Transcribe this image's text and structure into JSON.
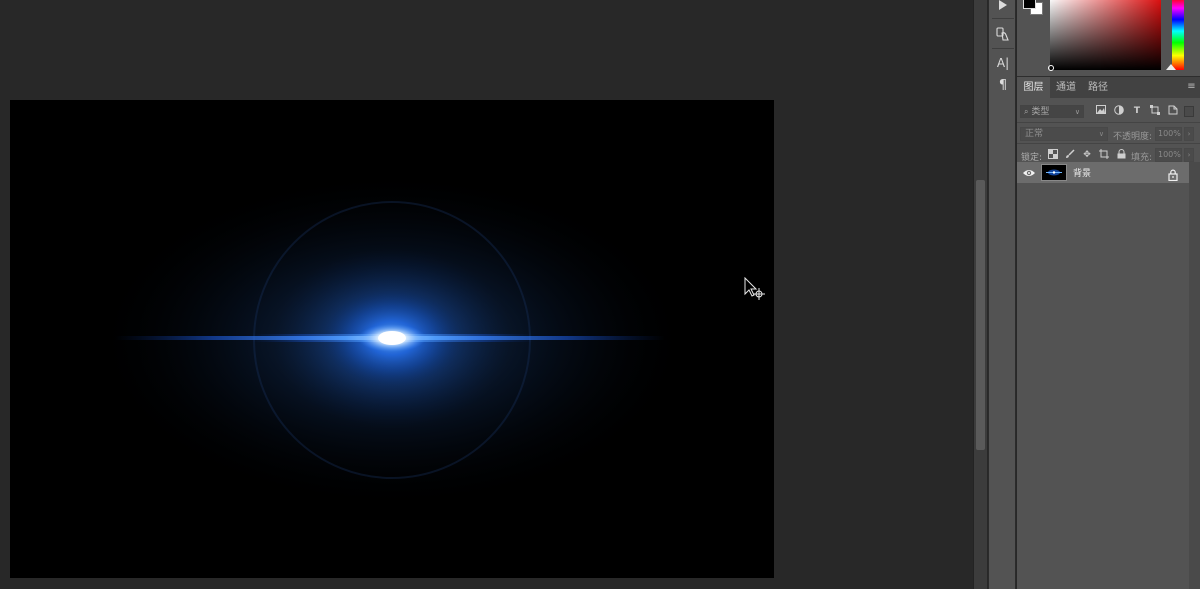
{
  "panel_tabs": [
    {
      "label": "图层",
      "active": true
    },
    {
      "label": "通道",
      "active": false
    },
    {
      "label": "路径",
      "active": false
    }
  ],
  "panel_menu_icon": "hamburger-menu-icon",
  "layers": {
    "filter": {
      "placeholder": "类型",
      "icons": [
        "image-filter-icon",
        "adjustment-filter-icon",
        "type-filter-icon",
        "shape-filter-icon",
        "smart-object-filter-icon"
      ]
    },
    "blend_mode": "正常",
    "opacity_label": "不透明度:",
    "opacity_value": "100%",
    "lock_label": "锁定:",
    "fill_label": "填充:",
    "fill_value": "100%",
    "items": [
      {
        "name": "背景",
        "visible": true,
        "locked": true,
        "selected": true
      }
    ]
  },
  "dock": {
    "icons": [
      "play-icon",
      "clone-source-icon",
      "character-icon",
      "paragraph-icon"
    ]
  },
  "colors": {
    "foreground": "#000000",
    "background": "#ffffff",
    "hue": "#ff0000",
    "workspace_bg": "#282828",
    "panel_bg": "#535353",
    "flare_blue": "#1e6fff"
  }
}
